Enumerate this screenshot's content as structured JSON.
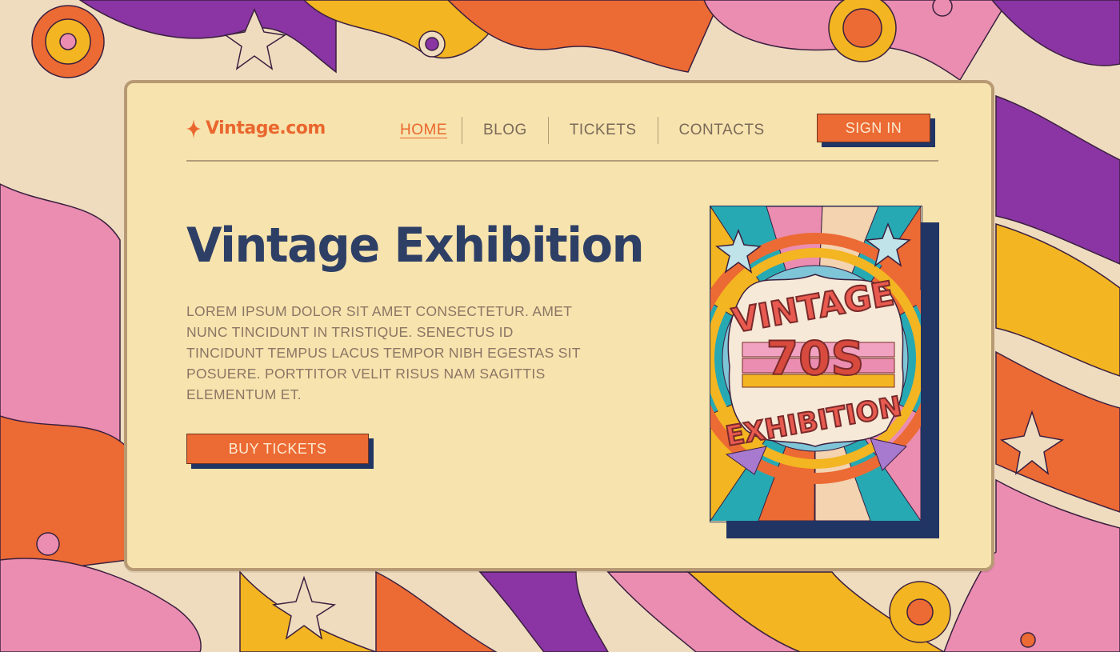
{
  "logo": {
    "text": "Vintage.com",
    "icon": "sparkle-icon"
  },
  "nav": {
    "items": [
      {
        "label": "HOME",
        "active": true
      },
      {
        "label": "BLOG",
        "active": false
      },
      {
        "label": "TICKETS",
        "active": false
      },
      {
        "label": "CONTACTS",
        "active": false
      }
    ]
  },
  "header": {
    "signin_label": "SIGN IN"
  },
  "hero": {
    "title": "Vintage Exhibition",
    "description": "LOREM IPSUM DOLOR SIT AMET CONSECTETUR. AMET NUNC TINCIDUNT IN TRISTIQUE. SENECTUS ID TINCIDUNT TEMPUS LACUS TEMPOR NIBH EGESTAS SIT POSUERE. PORTTITOR VELIT RISUS NAM SAGITTIS ELEMENTUM ET.",
    "cta_label": "BUY TICKETS"
  },
  "poster": {
    "line1": "VINTAGE",
    "line2": "70S",
    "line3": "EXHIBITION"
  },
  "colors": {
    "accent": "#ec6a34",
    "navy": "#213564",
    "title": "#2e3f66",
    "card": "#f7e3ad",
    "purple": "#8a35a3",
    "pink": "#ea8db0",
    "yellow": "#f3b521"
  }
}
